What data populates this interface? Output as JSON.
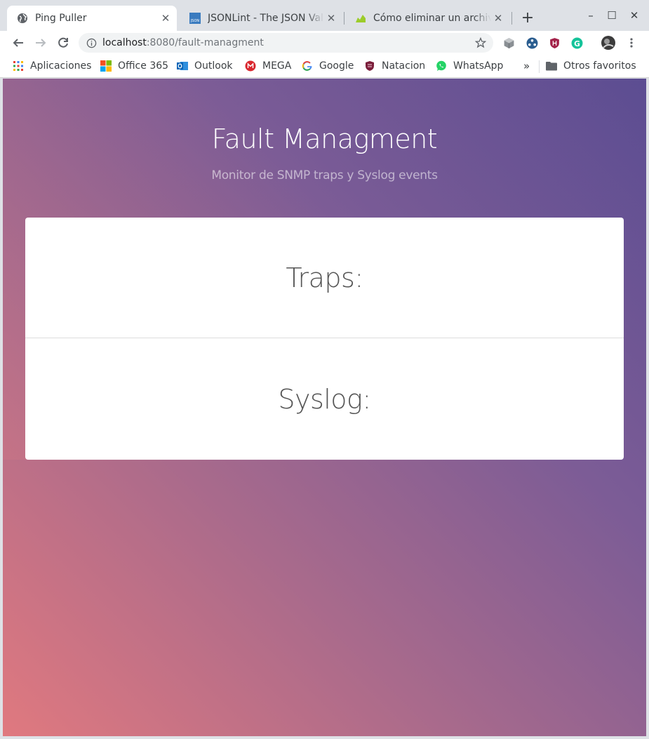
{
  "browser": {
    "tabs": [
      {
        "title": "Ping Puller",
        "icon": "globe-icon",
        "active": true
      },
      {
        "title": "JSONLint - The JSON Vali",
        "icon": "jsonlint-icon",
        "active": false
      },
      {
        "title": "Cómo eliminar un archivo",
        "icon": "chart-favicon-icon",
        "active": false
      }
    ],
    "new_tab_label": "+",
    "window_controls": {
      "minimize": "–",
      "maximize": "☐",
      "close": "✕"
    }
  },
  "toolbar": {
    "url_host": "localhost",
    "url_rest": ":8080/fault-managment"
  },
  "bookmarks": {
    "items": [
      {
        "label": "Aplicaciones",
        "icon": "apps-grid-icon"
      },
      {
        "label": "Office 365",
        "icon": "office-icon"
      },
      {
        "label": "Outlook",
        "icon": "outlook-icon"
      },
      {
        "label": "MEGA",
        "icon": "mega-icon"
      },
      {
        "label": "Google",
        "icon": "google-icon"
      },
      {
        "label": "Natacion",
        "icon": "natacion-icon"
      },
      {
        "label": "WhatsApp",
        "icon": "whatsapp-icon"
      }
    ],
    "more": "»",
    "other_label": "Otros favoritos"
  },
  "page": {
    "title": "Fault Managment",
    "subtitle": "Monitor de SNMP traps y Syslog events",
    "sections": [
      {
        "label": "Traps:"
      },
      {
        "label": "Syslog:"
      }
    ]
  },
  "colors": {
    "gradient_start": "#e0797f",
    "gradient_end": "#5c4d92",
    "card_background": "#ffffff"
  }
}
